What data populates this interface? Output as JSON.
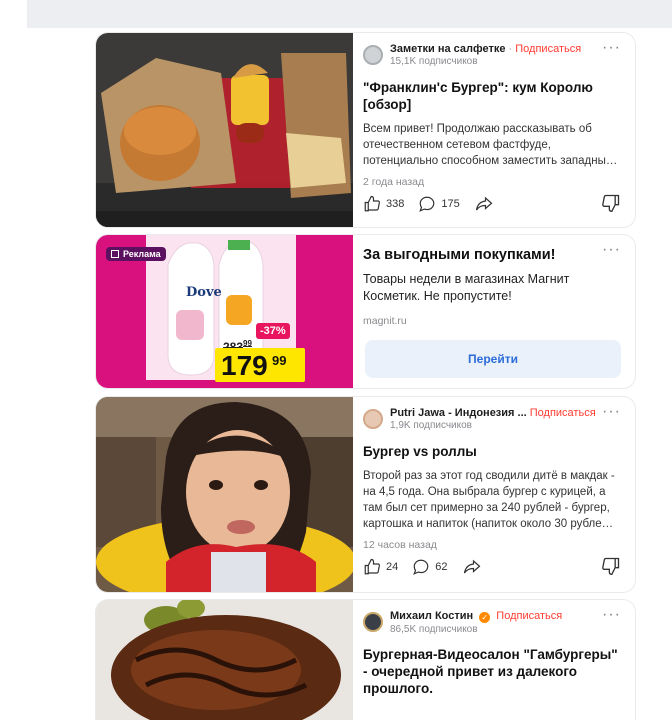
{
  "posts": [
    {
      "author": "Заметки на салфетке",
      "separator": "·",
      "subscribe": "Подписаться",
      "subscribers": "15,1K подписчиков",
      "more": "···",
      "title": "\"Франклин'с Бургер\": кум Королю [обзор]",
      "description": "Всем привет! Продолжаю рассказывать об отечественном сетевом фастфуде, потенциально способном заместить западны…",
      "time": "2 года назад",
      "likes": "338",
      "comments": "175"
    },
    {
      "author": "Putri Jawa - Индонезия ...",
      "subscribe": "Подписаться",
      "subscribers": "1,9K подписчиков",
      "more": "···",
      "title": "Бургер vs роллы",
      "description": "Второй раз за этот год сводили дитё в макдак - на 4,5 года. Она выбрала бургер с курицей, а там был сет примерно за 240 рублей - бургер, картошка и напиток (напиток около 30 рубле…",
      "time": "12 часов назад",
      "likes": "24",
      "comments": "62"
    },
    {
      "author": "Михаил Костин",
      "verified_mark": "✓",
      "subscribe": "Подписаться",
      "subscribers": "86,5K подписчиков",
      "more": "···",
      "title": "Бургерная-Видеосалон \"Гамбургеры\" - очередной привет из далекого прошлого."
    }
  ],
  "ad": {
    "badge": "Реклама",
    "more": "···",
    "title": "За выгодными покупками!",
    "text": "Товары недели в магазинах Магнит Косметик. Не пропустите!",
    "domain": "magnit.ru",
    "button": "Перейти",
    "discount": "-37%",
    "old_price": "283",
    "old_price_cents": "99",
    "new_price": "179",
    "new_price_cents": "99",
    "brand": "Dove"
  },
  "colors": {
    "subscribe": "#ff3b30",
    "ad_magenta": "#d9117f",
    "button_bg": "#eaf1fb",
    "button_text": "#2b6cd8"
  }
}
